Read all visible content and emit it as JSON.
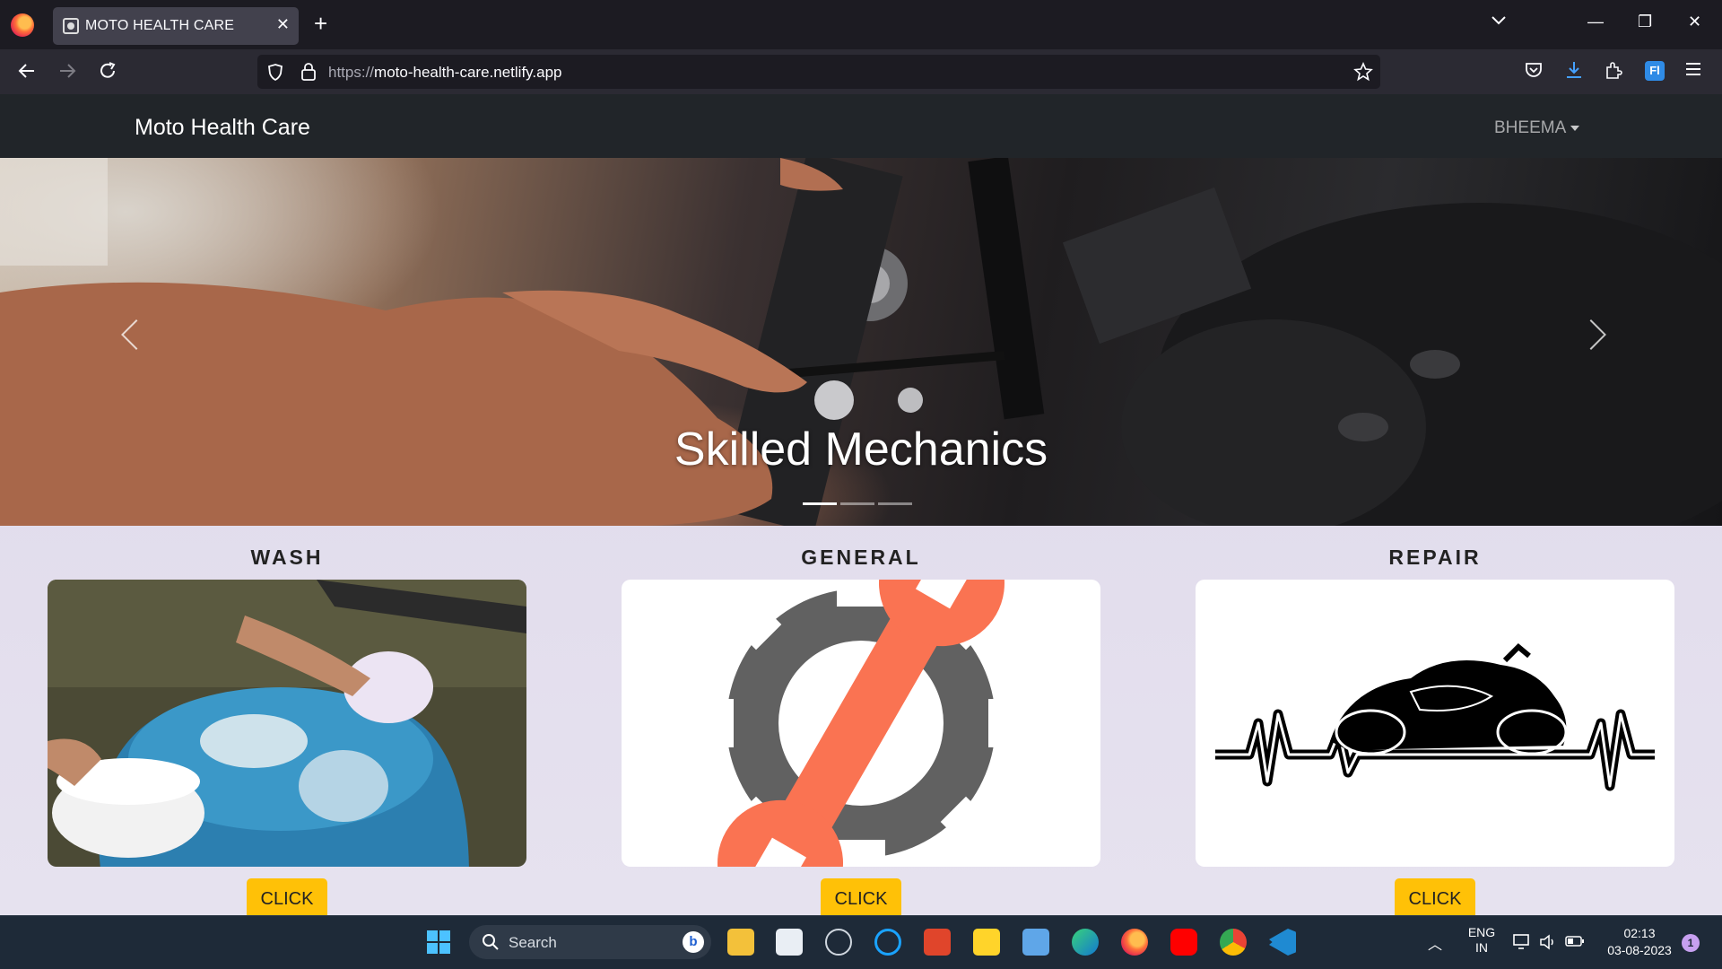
{
  "browser": {
    "tab_title": "MOTO HEALTH CARE",
    "url_protocol": "https://",
    "url_host": "moto-health-care.netlify.app"
  },
  "site": {
    "brand": "Moto Health Care",
    "user": "BHEEMA",
    "hero_caption": "Skilled Mechanics",
    "slides_total": 3,
    "slide_active": 1
  },
  "services": [
    {
      "title": "WASH",
      "button": "CLICK"
    },
    {
      "title": "GENERAL",
      "button": "CLICK"
    },
    {
      "title": "REPAIR",
      "button": "CLICK"
    }
  ],
  "taskbar": {
    "search_label": "Search",
    "lang_top": "ENG",
    "lang_bottom": "IN",
    "time": "02:13",
    "date": "03-08-2023",
    "notification_count": "1"
  },
  "colors": {
    "accent_button": "#ffc107",
    "site_nav": "#212529",
    "wrench": "#fa7352",
    "gear": "#616161"
  }
}
